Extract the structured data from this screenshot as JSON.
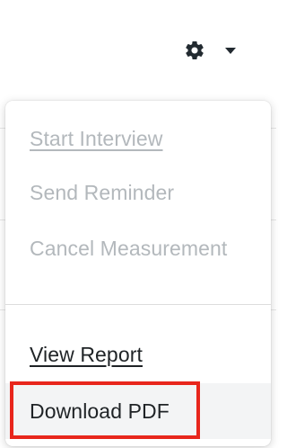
{
  "header": {
    "settings_icon": "gear-icon",
    "dropdown_icon": "caret-down-icon"
  },
  "menu": {
    "items": [
      {
        "label": "Start Interview",
        "state": "disabled"
      },
      {
        "label": "Send Reminder",
        "state": "disabled"
      },
      {
        "label": "Cancel Measurement",
        "state": "disabled"
      },
      {
        "label": "View Report",
        "state": "enabled"
      },
      {
        "label": "Download PDF",
        "state": "enabled"
      }
    ]
  },
  "colors": {
    "disabled_text": "#b3b8bc",
    "enabled_text": "#1f2326",
    "highlight": "#e8261c",
    "icon": "#222a30"
  }
}
